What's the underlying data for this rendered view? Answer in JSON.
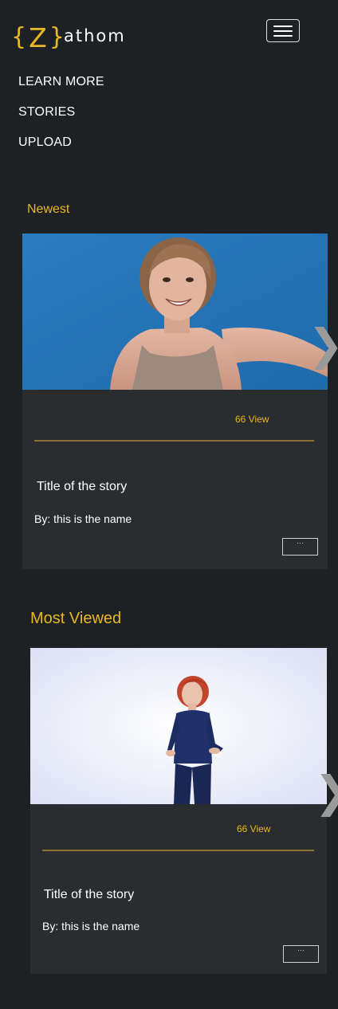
{
  "header": {
    "logo_brace_left": "{",
    "logo_letter": "Z",
    "logo_brace_right": "}",
    "brand_name": "athom",
    "menu_icon": "hamburger-menu-icon"
  },
  "nav": {
    "items": [
      "LEARN MORE",
      "STORIES",
      "UPLOAD"
    ]
  },
  "sections": {
    "newest": {
      "title": "Newest",
      "card": {
        "views": "66 View",
        "title": "Title of the story",
        "byline": "By: this is the name",
        "more_label": "···"
      }
    },
    "most_viewed": {
      "title": "Most Viewed",
      "card": {
        "views": "66 View",
        "title": "Title of the story",
        "byline": "By: this is the name",
        "more_label": "···"
      }
    }
  },
  "arrows": {
    "next_glyph": "❯",
    "icon": "chevron-right-icon"
  },
  "colors": {
    "background": "#1e2124",
    "card": "#2a2d30",
    "accent": "#e8b724",
    "divider": "#8a7235"
  }
}
